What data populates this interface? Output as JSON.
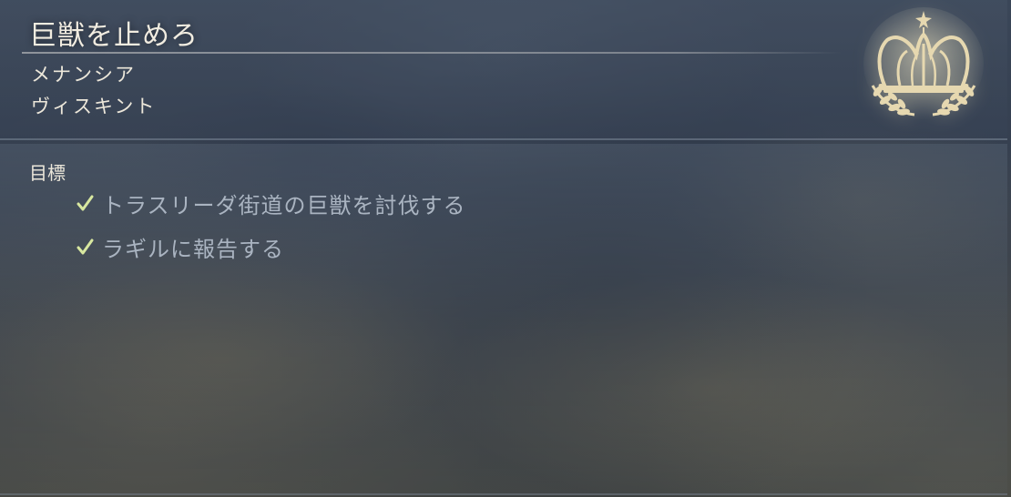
{
  "quest": {
    "title": "巨獣を止めろ",
    "locations": [
      "メナンシア",
      "ヴィスキント"
    ]
  },
  "objectives": {
    "label": "目標",
    "items": [
      {
        "text": "トラスリーダ街道の巨獣を討伐する",
        "completed": true
      },
      {
        "text": "ラギルに報告する",
        "completed": true
      }
    ]
  },
  "icons": {
    "emblem": "crown-laurel-icon",
    "check": "check-icon"
  },
  "colors": {
    "title_text": "#f1ece0",
    "objective_text": "#aab4c1",
    "check_mark": "#d8e8a0",
    "emblem_gold": "#e6d8b0"
  }
}
